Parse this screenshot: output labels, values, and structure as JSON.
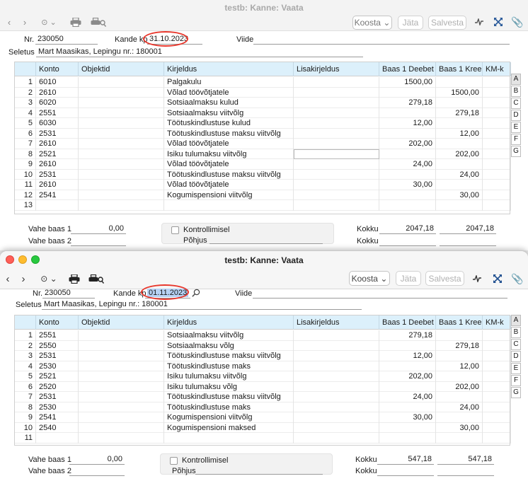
{
  "window1": {
    "title": "testb: Kanne: Vaata",
    "toolbar": {
      "koosta": "Koosta",
      "jata": "Jäta",
      "salvesta": "Salvesta"
    },
    "header": {
      "nr_label": "Nr.",
      "nr_value": "230050",
      "kande_label": "Kande kp",
      "kande_value": "31.10.2023",
      "viide_label": "Viide",
      "viide_value": "",
      "seletus_label": "Seletus",
      "seletus_value": "Mart Maasikas,  Lepingu nr.: 180001"
    },
    "grid": {
      "columns": [
        "Konto",
        "Objektid",
        "Kirjeldus",
        "Lisakirjeldus",
        "Baas 1 Deebet",
        "Baas 1 Kree...",
        "KM-k"
      ],
      "rows": [
        {
          "n": "1",
          "konto": "6010",
          "kirjeldus": "Palgakulu",
          "deebet": "1500,00",
          "kreedit": ""
        },
        {
          "n": "2",
          "konto": "2610",
          "kirjeldus": "Võlad töövõtjatele",
          "deebet": "",
          "kreedit": "1500,00"
        },
        {
          "n": "3",
          "konto": "6020",
          "kirjeldus": "Sotsiaalmaksu kulud",
          "deebet": "279,18",
          "kreedit": ""
        },
        {
          "n": "4",
          "konto": "2551",
          "kirjeldus": "Sotsiaalmaksu viitvõlg",
          "deebet": "",
          "kreedit": "279,18"
        },
        {
          "n": "5",
          "konto": "6030",
          "kirjeldus": "Töötuskindlustuse kulud",
          "deebet": "12,00",
          "kreedit": ""
        },
        {
          "n": "6",
          "konto": "2531",
          "kirjeldus": "Töötuskindlustuse maksu viitvõlg",
          "deebet": "",
          "kreedit": "12,00"
        },
        {
          "n": "7",
          "konto": "2610",
          "kirjeldus": "Võlad töövõtjatele",
          "deebet": "202,00",
          "kreedit": ""
        },
        {
          "n": "8",
          "konto": "2521",
          "kirjeldus": "Isiku tulumaksu viitvõlg",
          "deebet": "",
          "kreedit": "202,00"
        },
        {
          "n": "9",
          "konto": "2610",
          "kirjeldus": "Võlad töövõtjatele",
          "deebet": "24,00",
          "kreedit": ""
        },
        {
          "n": "10",
          "konto": "2531",
          "kirjeldus": "Töötuskindlustuse maksu viitvõlg",
          "deebet": "",
          "kreedit": "24,00"
        },
        {
          "n": "11",
          "konto": "2610",
          "kirjeldus": "Võlad töövõtjatele",
          "deebet": "30,00",
          "kreedit": ""
        },
        {
          "n": "12",
          "konto": "2541",
          "kirjeldus": "Kogumispensioni viitvõlg",
          "deebet": "",
          "kreedit": "30,00"
        },
        {
          "n": "13",
          "konto": "",
          "kirjeldus": "",
          "deebet": "",
          "kreedit": ""
        }
      ]
    },
    "tabs": [
      "A",
      "B",
      "C",
      "D",
      "E",
      "F",
      "G"
    ],
    "footer": {
      "vahe1_label": "Vahe baas 1",
      "vahe1_value": "0,00",
      "vahe2_label": "Vahe baas 2",
      "vahe2_value": "",
      "kontroll_label": "Kontrollimisel",
      "pohjus_label": "Põhjus",
      "kokku_label": "Kokku",
      "kokku_deebet": "2047,18",
      "kokku_kreedit": "2047,18",
      "kokku2_label": "Kokku"
    }
  },
  "window2": {
    "title": "testb: Kanne: Vaata",
    "toolbar": {
      "koosta": "Koosta",
      "jata": "Jäta",
      "salvesta": "Salvesta"
    },
    "header": {
      "nr_label": "Nr.",
      "nr_value": "230050",
      "kande_label": "Kande kp",
      "kande_value": "01.11.2023",
      "viide_label": "Viide",
      "viide_value": "",
      "seletus_label": "Seletus",
      "seletus_value": "Mart Maasikas,  Lepingu nr.: 180001"
    },
    "grid": {
      "columns": [
        "Konto",
        "Objektid",
        "Kirjeldus",
        "Lisakirjeldus",
        "Baas 1 Deebet",
        "Baas 1 Kree...",
        "KM-k"
      ],
      "rows": [
        {
          "n": "1",
          "konto": "2551",
          "kirjeldus": "Sotsiaalmaksu viitvõlg",
          "deebet": "279,18",
          "kreedit": ""
        },
        {
          "n": "2",
          "konto": "2550",
          "kirjeldus": "Sotsiaalmaksu võlg",
          "deebet": "",
          "kreedit": "279,18"
        },
        {
          "n": "3",
          "konto": "2531",
          "kirjeldus": "Töötuskindlustuse maksu viitvõlg",
          "deebet": "12,00",
          "kreedit": ""
        },
        {
          "n": "4",
          "konto": "2530",
          "kirjeldus": "Töötuskindlustuse maks",
          "deebet": "",
          "kreedit": "12,00"
        },
        {
          "n": "5",
          "konto": "2521",
          "kirjeldus": "Isiku tulumaksu viitvõlg",
          "deebet": "202,00",
          "kreedit": ""
        },
        {
          "n": "6",
          "konto": "2520",
          "kirjeldus": "Isiku tulumaksu võlg",
          "deebet": "",
          "kreedit": "202,00"
        },
        {
          "n": "7",
          "konto": "2531",
          "kirjeldus": "Töötuskindlustuse maksu viitvõlg",
          "deebet": "24,00",
          "kreedit": ""
        },
        {
          "n": "8",
          "konto": "2530",
          "kirjeldus": "Töötuskindlustuse maks",
          "deebet": "",
          "kreedit": "24,00"
        },
        {
          "n": "9",
          "konto": "2541",
          "kirjeldus": "Kogumispensioni viitvõlg",
          "deebet": "30,00",
          "kreedit": ""
        },
        {
          "n": "10",
          "konto": "2540",
          "kirjeldus": "Kogumispensioni maksed",
          "deebet": "",
          "kreedit": "30,00"
        },
        {
          "n": "11",
          "konto": "",
          "kirjeldus": "",
          "deebet": "",
          "kreedit": ""
        }
      ]
    },
    "tabs": [
      "A",
      "B",
      "C",
      "D",
      "E",
      "F",
      "G"
    ],
    "footer": {
      "vahe1_label": "Vahe baas 1",
      "vahe1_value": "0,00",
      "vahe2_label": "Vahe baas 2",
      "vahe2_value": "",
      "kontroll_label": "Kontrollimisel",
      "pohjus_label": "Põhjus",
      "kokku_label": "Kokku",
      "kokku_deebet": "547,18",
      "kokku_kreedit": "547,18",
      "kokku2_label": "Kokku"
    }
  },
  "icons": [
    "chevron-left-icon",
    "chevron-right-icon",
    "more-icon",
    "print-icon",
    "print-preview-icon",
    "activity-icon",
    "expand-icon",
    "attachment-icon",
    "search-icon"
  ],
  "colors": {
    "grid_header": "#dcf0fb",
    "highlight_circle": "#e8362b",
    "selection": "#b7d3f5"
  }
}
